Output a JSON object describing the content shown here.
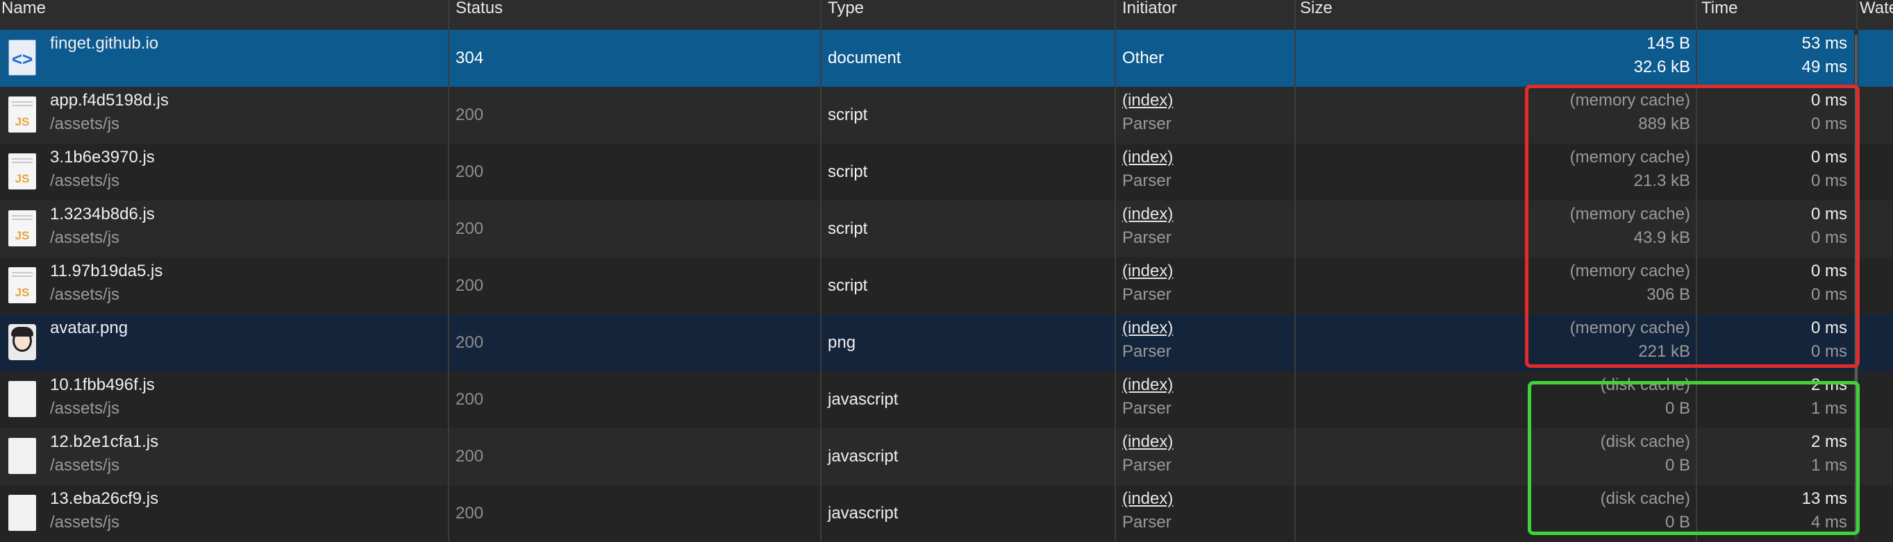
{
  "columns": {
    "name": "Name",
    "status": "Status",
    "type": "Type",
    "initiator": "Initiator",
    "size": "Size",
    "time": "Time",
    "waterfall": "Waterfall"
  },
  "rows": [
    {
      "icon": "html-document-icon",
      "name": "finget.github.io",
      "path": "",
      "status": "304",
      "type": "document",
      "initiator": "Other",
      "initiator_sub": "",
      "size1": "145 B",
      "size2": "32.6 kB",
      "time1": "53 ms",
      "time2": "49 ms"
    },
    {
      "icon": "js-file-icon",
      "name": "app.f4d5198d.js",
      "path": "/assets/js",
      "status": "200",
      "type": "script",
      "initiator": "(index)",
      "initiator_sub": "Parser",
      "size1": "(memory cache)",
      "size2": "889 kB",
      "time1": "0 ms",
      "time2": "0 ms"
    },
    {
      "icon": "js-file-icon",
      "name": "3.1b6e3970.js",
      "path": "/assets/js",
      "status": "200",
      "type": "script",
      "initiator": "(index)",
      "initiator_sub": "Parser",
      "size1": "(memory cache)",
      "size2": "21.3 kB",
      "time1": "0 ms",
      "time2": "0 ms"
    },
    {
      "icon": "js-file-icon",
      "name": "1.3234b8d6.js",
      "path": "/assets/js",
      "status": "200",
      "type": "script",
      "initiator": "(index)",
      "initiator_sub": "Parser",
      "size1": "(memory cache)",
      "size2": "43.9 kB",
      "time1": "0 ms",
      "time2": "0 ms"
    },
    {
      "icon": "js-file-icon",
      "name": "11.97b19da5.js",
      "path": "/assets/js",
      "status": "200",
      "type": "script",
      "initiator": "(index)",
      "initiator_sub": "Parser",
      "size1": "(memory cache)",
      "size2": "306 B",
      "time1": "0 ms",
      "time2": "0 ms"
    },
    {
      "icon": "avatar-image-icon",
      "name": "avatar.png",
      "path": "",
      "status": "200",
      "type": "png",
      "initiator": "(index)",
      "initiator_sub": "Parser",
      "size1": "(memory cache)",
      "size2": "221 kB",
      "time1": "0 ms",
      "time2": "0 ms"
    },
    {
      "icon": "blank-file-icon",
      "name": "10.1fbb496f.js",
      "path": "/assets/js",
      "status": "200",
      "type": "javascript",
      "initiator": "(index)",
      "initiator_sub": "Parser",
      "size1": "(disk cache)",
      "size2": "0 B",
      "time1": "2 ms",
      "time2": "1 ms"
    },
    {
      "icon": "blank-file-icon",
      "name": "12.b2e1cfa1.js",
      "path": "/assets/js",
      "status": "200",
      "type": "javascript",
      "initiator": "(index)",
      "initiator_sub": "Parser",
      "size1": "(disk cache)",
      "size2": "0 B",
      "time1": "2 ms",
      "time2": "1 ms"
    },
    {
      "icon": "blank-file-icon",
      "name": "13.eba26cf9.js",
      "path": "/assets/js",
      "status": "200",
      "type": "javascript",
      "initiator": "(index)",
      "initiator_sub": "Parser",
      "size1": "(disk cache)",
      "size2": "0 B",
      "time1": "13 ms",
      "time2": "4 ms"
    }
  ],
  "icons": {
    "js_label": "JS",
    "doc_label": "<>"
  },
  "colors": {
    "selected_row": "#0d5a8f",
    "memory_cache_box": "#e22b2b",
    "disk_cache_box": "#3fd33a"
  }
}
